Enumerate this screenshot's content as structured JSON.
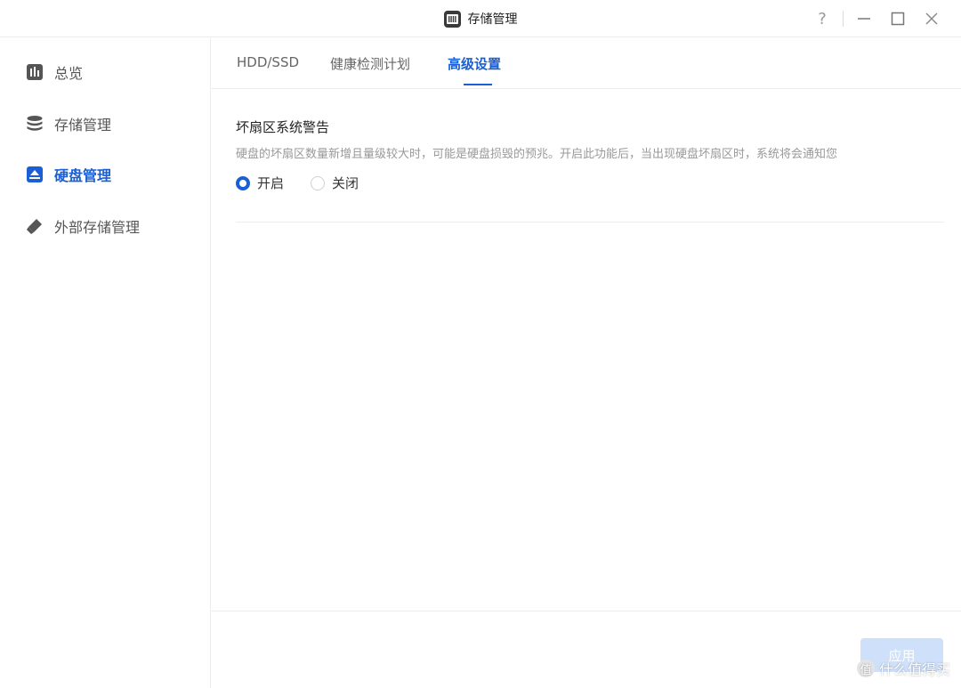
{
  "window": {
    "title": "存储管理",
    "help_label": "?"
  },
  "sidebar": {
    "items": [
      {
        "label": "总览",
        "icon": "chart-icon",
        "active": false
      },
      {
        "label": "存储管理",
        "icon": "database-icon",
        "active": false
      },
      {
        "label": "硬盘管理",
        "icon": "disk-icon",
        "active": true
      },
      {
        "label": "外部存储管理",
        "icon": "usb-drive-icon",
        "active": false
      }
    ]
  },
  "tabs": [
    {
      "label": "HDD/SSD",
      "active": false
    },
    {
      "label": "健康检测计划",
      "active": false
    },
    {
      "label": "高级设置",
      "active": true
    }
  ],
  "setting": {
    "title": "坏扇区系统警告",
    "description": "硬盘的坏扇区数量新增且量级较大时，可能是硬盘损毁的预兆。开启此功能后，当出现硬盘坏扇区时，系统将会通知您",
    "options": [
      {
        "label": "开启",
        "selected": true
      },
      {
        "label": "关闭",
        "selected": false
      }
    ]
  },
  "footer": {
    "apply_label": "应用"
  },
  "watermark": {
    "badge": "值",
    "text": "什么值得买"
  },
  "colors": {
    "accent": "#1a5fd6",
    "apply_disabled": "#cfe0fb"
  }
}
